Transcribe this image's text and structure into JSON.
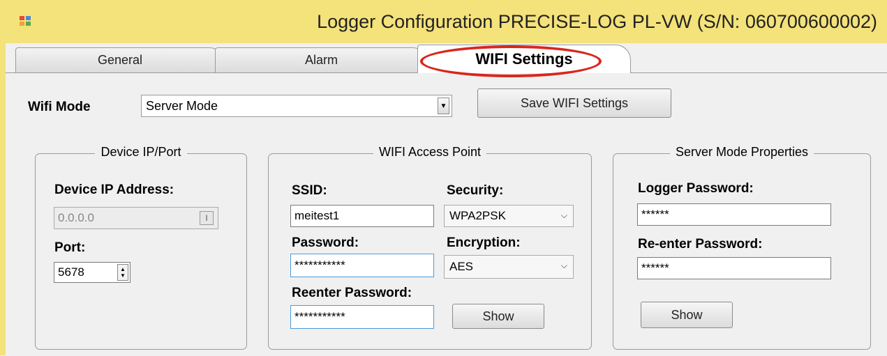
{
  "window": {
    "title": "Logger Configuration PRECISE-LOG PL-VW (S/N: 060700600002)"
  },
  "tabs": [
    {
      "label": "General",
      "active": false
    },
    {
      "label": "Alarm",
      "active": false
    },
    {
      "label": "WIFI Settings",
      "active": true
    }
  ],
  "wifi_mode": {
    "label": "Wifi Mode",
    "value": "Server Mode",
    "save_button": "Save WIFI Settings"
  },
  "device": {
    "group_title": "Device IP/Port",
    "ip_label": "Device IP Address:",
    "ip_value": "0.0.0.0",
    "port_label": "Port:",
    "port_value": "5678"
  },
  "access_point": {
    "group_title": "WIFI Access Point",
    "ssid_label": "SSID:",
    "ssid_value": "meitest1",
    "security_label": "Security:",
    "security_value": "WPA2PSK",
    "password_label": "Password:",
    "password_value": "***********",
    "encryption_label": "Encryption:",
    "encryption_value": "AES",
    "reenter_label": "Reenter Password:",
    "reenter_value": "***********",
    "show_button": "Show"
  },
  "server_mode": {
    "group_title": "Server Mode Properties",
    "logger_password_label": "Logger Password:",
    "logger_password_value": "******",
    "reenter_label": "Re-enter Password:",
    "reenter_value": "******",
    "show_button": "Show"
  },
  "colors": {
    "titlebar": "#f4e27a",
    "highlight": "#d9261c"
  }
}
